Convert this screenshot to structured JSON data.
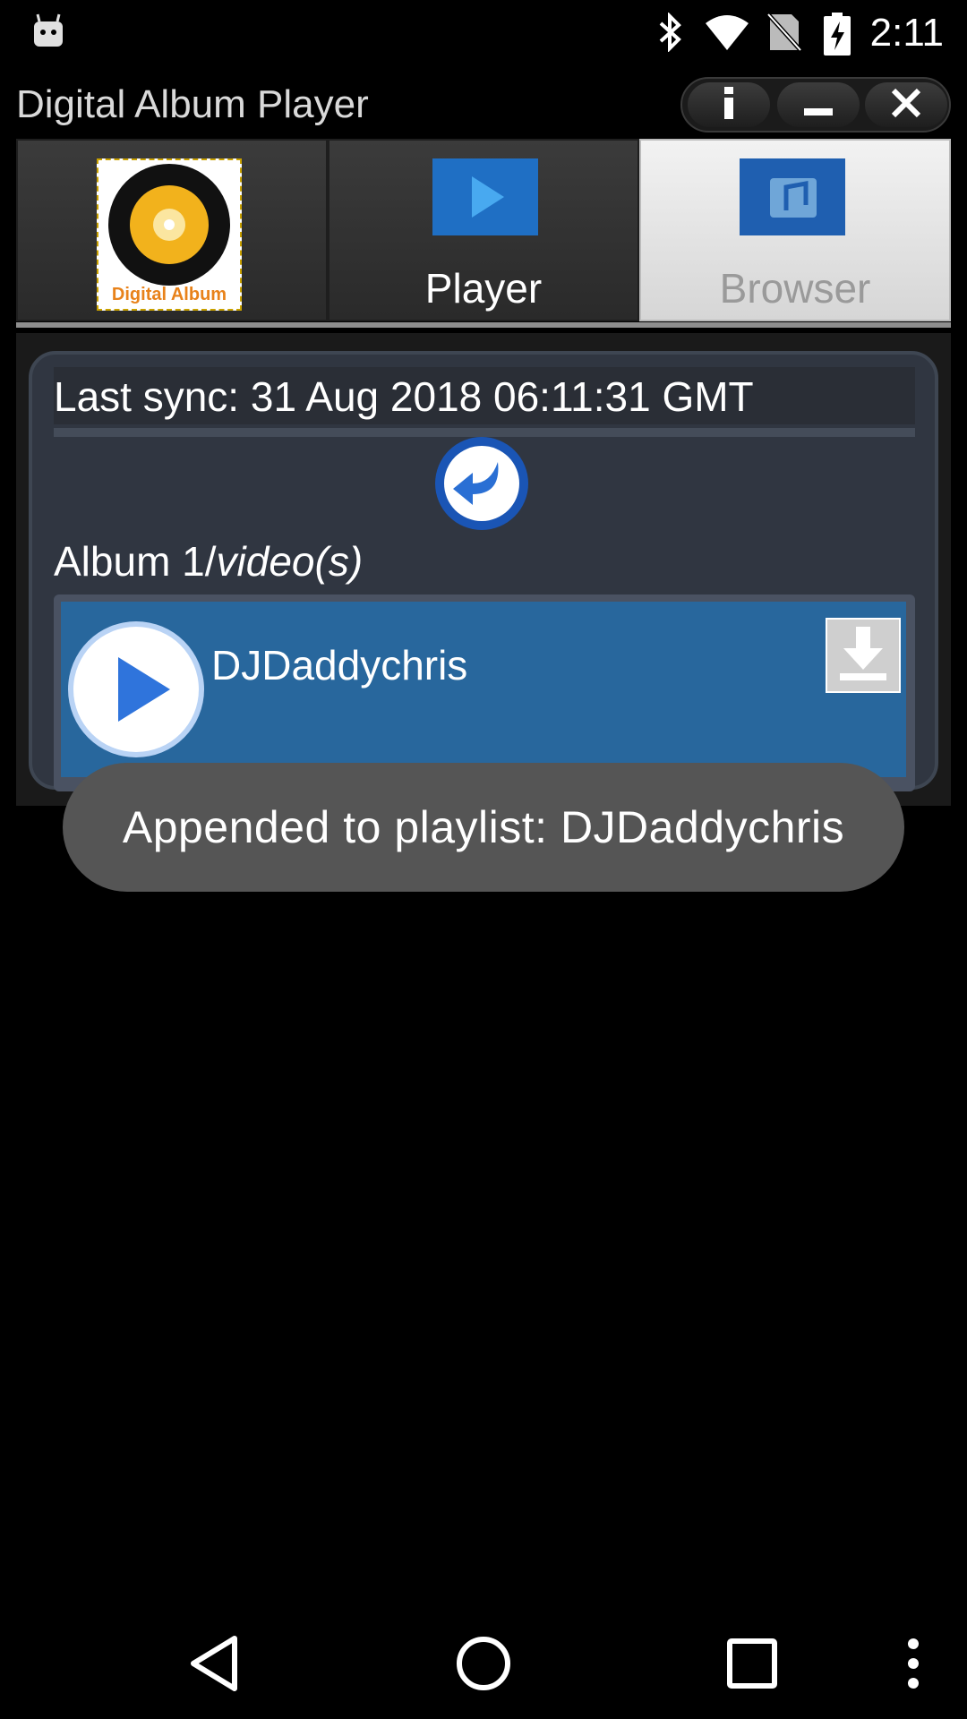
{
  "status_bar": {
    "time": "2:11",
    "icons": [
      "android-debug-icon",
      "bluetooth-icon",
      "wifi-icon",
      "no-sim-icon",
      "battery-charging-icon"
    ]
  },
  "app": {
    "title": "Digital Album Player",
    "window_controls": [
      "info-icon",
      "minimize-icon",
      "close-icon"
    ]
  },
  "tabs": [
    {
      "label": "",
      "icon": "digital-album-logo",
      "logo_text": "Digital Album"
    },
    {
      "label": "Player",
      "icon": "play-tab-icon"
    },
    {
      "label": "Browser",
      "icon": "browser-tab-icon",
      "selected": true
    }
  ],
  "browser": {
    "last_sync": "Last sync: 31 Aug 2018 06:11:31 GMT",
    "album_label_prefix": "Album 1/",
    "album_label_suffix": "video(s)",
    "tracks": [
      {
        "title": "DJDaddychris"
      }
    ]
  },
  "toast": {
    "message": "Appended to playlist: DJDaddychris"
  },
  "nav_bar": [
    "back-icon",
    "home-icon",
    "recents-icon",
    "overflow-menu-icon"
  ],
  "colors": {
    "panel": "#303641",
    "track_row": "#28679d",
    "selected_tab": "#e8e8e8",
    "toast": "#555555"
  }
}
